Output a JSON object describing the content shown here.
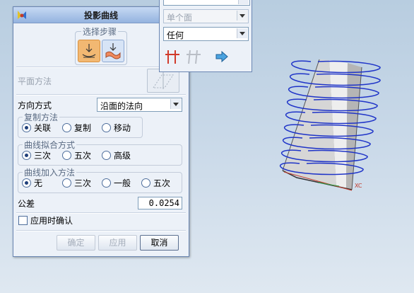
{
  "dialog": {
    "title": "投影曲线",
    "steps_label": "选择步骤",
    "plane_method_label": "平面方法",
    "direction_label": "方向方式",
    "direction_value": "沿面的法向",
    "copy_method": {
      "legend": "复制方法",
      "options": [
        "关联",
        "复制",
        "移动"
      ],
      "selected": 0
    },
    "fit_method": {
      "legend": "曲线拟合方式",
      "options": [
        "三次",
        "五次",
        "高级"
      ],
      "selected": 0
    },
    "join_method": {
      "legend": "曲线加入方法",
      "options": [
        "无",
        "三次",
        "一般",
        "五次"
      ],
      "selected": 0
    },
    "tolerance_label": "公差",
    "tolerance_value": "0.0254",
    "confirm_on_apply_label": "应用时确认",
    "confirm_on_apply_checked": false,
    "buttons": {
      "ok": "确定",
      "apply": "应用",
      "cancel": "取消"
    }
  },
  "popup": {
    "face_select_value": "单个面",
    "filter_select_value": "任何"
  },
  "colors": {
    "accent": "#f2b872",
    "curve": "#1f34c8",
    "title_gradient": "#94b3df"
  }
}
